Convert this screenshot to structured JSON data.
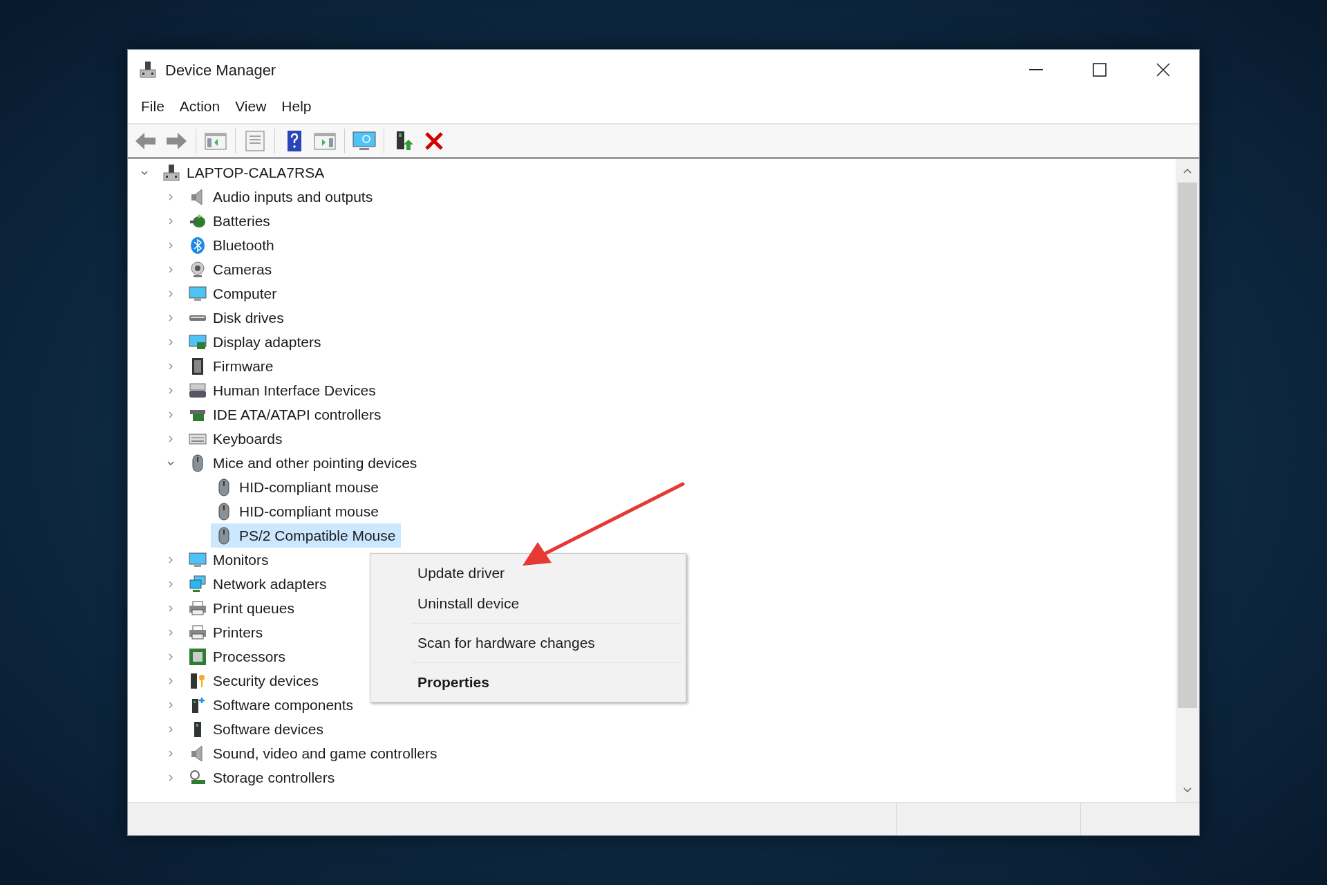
{
  "window": {
    "title": "Device Manager"
  },
  "menu": [
    "File",
    "Action",
    "View",
    "Help"
  ],
  "toolbar": [
    {
      "kind": "back"
    },
    {
      "kind": "forward"
    },
    {
      "kind": "sep"
    },
    {
      "kind": "tree"
    },
    {
      "kind": "sep"
    },
    {
      "kind": "properties"
    },
    {
      "kind": "sep"
    },
    {
      "kind": "help"
    },
    {
      "kind": "pane"
    },
    {
      "kind": "sep"
    },
    {
      "kind": "scan"
    },
    {
      "kind": "sep"
    },
    {
      "kind": "update"
    },
    {
      "kind": "uninstall"
    }
  ],
  "tree": {
    "label": "LAPTOP-CALA7RSA",
    "kind": "computer-root",
    "expanded": true,
    "selected": false,
    "children": [
      {
        "label": "Audio inputs and outputs",
        "kind": "speaker",
        "expanded": false,
        "selected": false
      },
      {
        "label": "Batteries",
        "kind": "battery",
        "expanded": false,
        "selected": false
      },
      {
        "label": "Bluetooth",
        "kind": "bluetooth",
        "expanded": false,
        "selected": false
      },
      {
        "label": "Cameras",
        "kind": "camera",
        "expanded": false,
        "selected": false
      },
      {
        "label": "Computer",
        "kind": "monitor",
        "expanded": false,
        "selected": false
      },
      {
        "label": "Disk drives",
        "kind": "disk",
        "expanded": false,
        "selected": false
      },
      {
        "label": "Display adapters",
        "kind": "display",
        "expanded": false,
        "selected": false
      },
      {
        "label": "Firmware",
        "kind": "chip",
        "expanded": false,
        "selected": false
      },
      {
        "label": "Human Interface Devices",
        "kind": "hid",
        "expanded": false,
        "selected": false
      },
      {
        "label": "IDE ATA/ATAPI controllers",
        "kind": "board",
        "expanded": false,
        "selected": false
      },
      {
        "label": "Keyboards",
        "kind": "keyboard",
        "expanded": false,
        "selected": false
      },
      {
        "label": "Mice and other pointing devices",
        "kind": "mouse",
        "expanded": true,
        "selected": false,
        "children": [
          {
            "label": "HID-compliant mouse",
            "kind": "mouse",
            "selected": false
          },
          {
            "label": "HID-compliant mouse",
            "kind": "mouse",
            "selected": false
          },
          {
            "label": "PS/2 Compatible Mouse",
            "kind": "mouse",
            "selected": true
          }
        ]
      },
      {
        "label": "Monitors",
        "kind": "monitor",
        "expanded": false,
        "selected": false
      },
      {
        "label": "Network adapters",
        "kind": "network",
        "expanded": false,
        "selected": false
      },
      {
        "label": "Print queues",
        "kind": "printer",
        "expanded": false,
        "selected": false
      },
      {
        "label": "Printers",
        "kind": "printer",
        "expanded": false,
        "selected": false
      },
      {
        "label": "Processors",
        "kind": "processor",
        "expanded": false,
        "selected": false
      },
      {
        "label": "Security devices",
        "kind": "security",
        "expanded": false,
        "selected": false
      },
      {
        "label": "Software components",
        "kind": "software-component",
        "expanded": false,
        "selected": false
      },
      {
        "label": "Software devices",
        "kind": "software-device",
        "expanded": false,
        "selected": false
      },
      {
        "label": "Sound, video and game controllers",
        "kind": "speaker",
        "expanded": false,
        "selected": false
      },
      {
        "label": "Storage controllers",
        "kind": "storage",
        "expanded": false,
        "selected": false
      }
    ]
  },
  "context_menu": [
    {
      "kind": "item",
      "label": "Update driver",
      "default": false
    },
    {
      "kind": "item",
      "label": "Uninstall device",
      "default": false
    },
    {
      "kind": "separator"
    },
    {
      "kind": "item",
      "label": "Scan for hardware changes",
      "default": false
    },
    {
      "kind": "separator"
    },
    {
      "kind": "item",
      "label": "Properties",
      "default": true
    }
  ]
}
